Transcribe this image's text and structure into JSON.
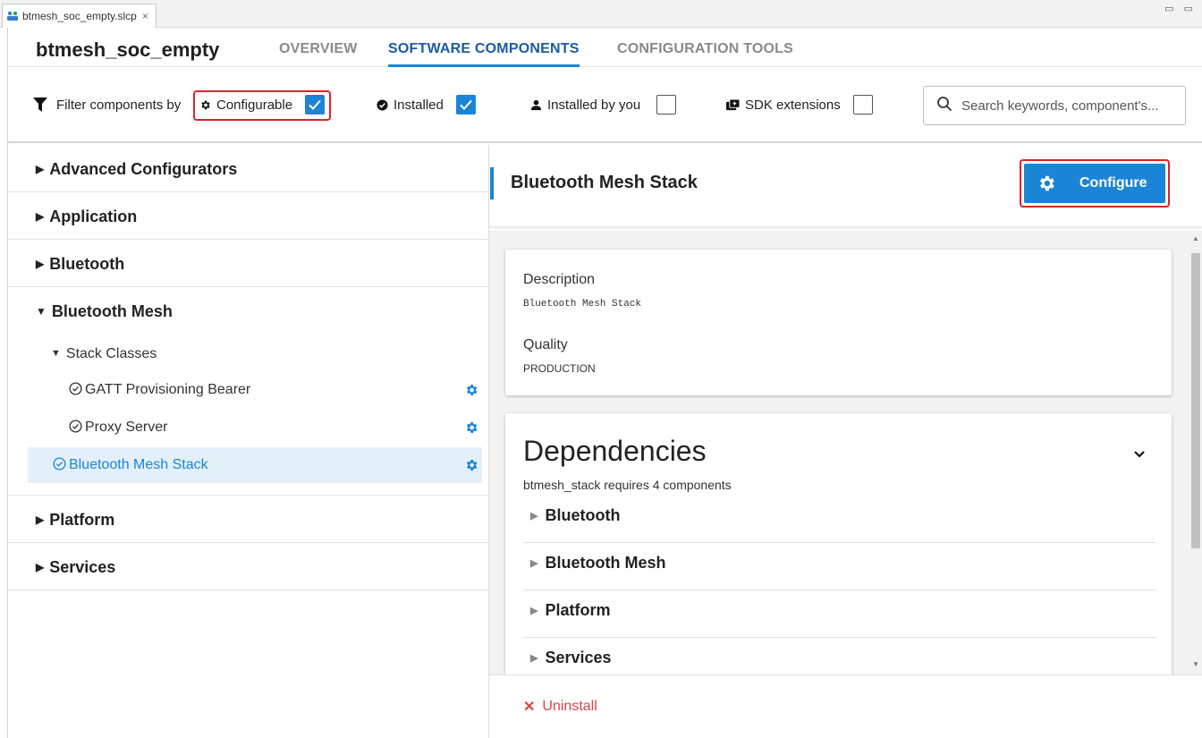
{
  "editor_tab": {
    "filename": "btmesh_soc_empty.slcp",
    "close": "×"
  },
  "window_controls": "▭ ▭",
  "header": {
    "project_title": "btmesh_soc_empty",
    "tabs": [
      "OVERVIEW",
      "SOFTWARE COMPONENTS",
      "CONFIGURATION TOOLS"
    ],
    "active_tab": "SOFTWARE COMPONENTS"
  },
  "filters": {
    "label": "Filter components by",
    "configurable": {
      "label": "Configurable",
      "checked": true
    },
    "installed": {
      "label": "Installed",
      "checked": true
    },
    "installed_by_you": {
      "label": "Installed by you",
      "checked": false
    },
    "sdk_extensions": {
      "label": "SDK extensions",
      "checked": false
    },
    "search_placeholder": "Search keywords, component's..."
  },
  "tree": {
    "categories": [
      "Advanced Configurators",
      "Application",
      "Bluetooth",
      "Bluetooth Mesh",
      "Platform",
      "Services"
    ],
    "expanded": "Bluetooth Mesh",
    "subgroup": "Stack Classes",
    "stack_items": [
      "GATT Provisioning Bearer",
      "Proxy Server"
    ],
    "selected_item": "Bluetooth Mesh Stack"
  },
  "detail": {
    "title": "Bluetooth Mesh Stack",
    "configure_label": "Configure",
    "description_label": "Description",
    "description_value": "Bluetooth Mesh Stack",
    "quality_label": "Quality",
    "quality_value": "PRODUCTION",
    "dependencies_title": "Dependencies",
    "dependencies_summary": "btmesh_stack requires 4 components",
    "dependencies": [
      "Bluetooth",
      "Bluetooth Mesh",
      "Platform",
      "Services"
    ],
    "uninstall_label": "Uninstall"
  },
  "colors": {
    "accent": "#1b84d6",
    "highlight": "#e0202a",
    "danger": "#d9434a",
    "selected_bg": "#e3f0f9"
  }
}
